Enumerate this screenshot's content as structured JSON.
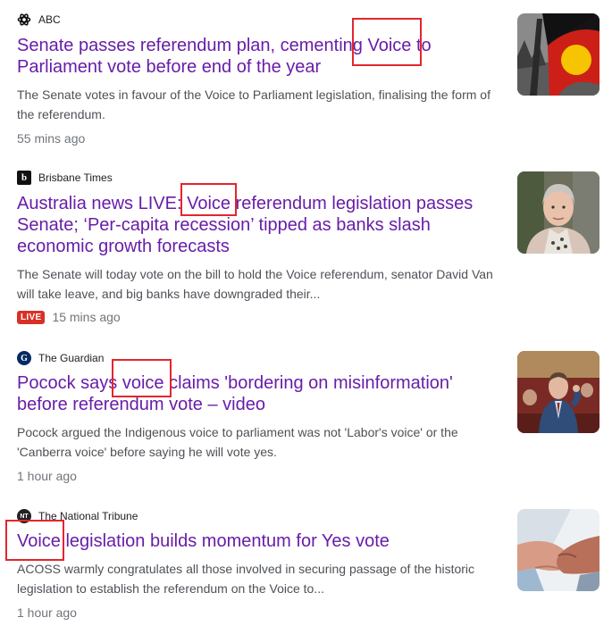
{
  "articles": [
    {
      "source": "ABC",
      "source_icon": "abc-logo-icon",
      "headline": "Senate passes referendum plan, cementing Voice to Parliament vote before end of the year",
      "snippet": "The Senate votes in favour of the Voice to Parliament legislation, finalising the form of the referendum.",
      "time": "55 mins ago",
      "thumbnail": "aboriginal-flag-image"
    },
    {
      "source": "Brisbane Times",
      "source_icon": "brisbane-times-logo-icon",
      "headline": "Australia news LIVE: Voice referendum legislation passes Senate; ‘Per-capita recession’ tipped as banks slash economic growth forecasts",
      "snippet": "The Senate will today vote on the bill to hold the Voice referendum, senator David Van will take leave, and big banks have downgraded their...",
      "live_label": "LIVE",
      "time": "15 mins ago",
      "thumbnail": "portrait-woman-image"
    },
    {
      "source": "The Guardian",
      "source_icon": "guardian-logo-icon",
      "headline": "Pocock says voice claims 'bordering on misinformation' before referendum vote – video",
      "snippet": "Pocock argued the Indigenous voice to parliament was not 'Labor's voice' or the 'Canberra voice' before saying he will vote yes.",
      "time": "1 hour ago",
      "thumbnail": "senator-speaking-image"
    },
    {
      "source": "The National Tribune",
      "source_icon": "national-tribune-logo-icon",
      "headline": "Voice legislation builds momentum for Yes vote",
      "snippet": "ACOSS warmly congratulates all those involved in securing passage of the historic legislation to establish the referendum on the Voice to...",
      "time": "1 hour ago",
      "thumbnail": "holding-hands-image"
    }
  ],
  "colors": {
    "headline": "#681da8",
    "snippet": "#4d5156",
    "meta": "#70757a",
    "live": "#d93025",
    "highlight": "#e3262d"
  }
}
